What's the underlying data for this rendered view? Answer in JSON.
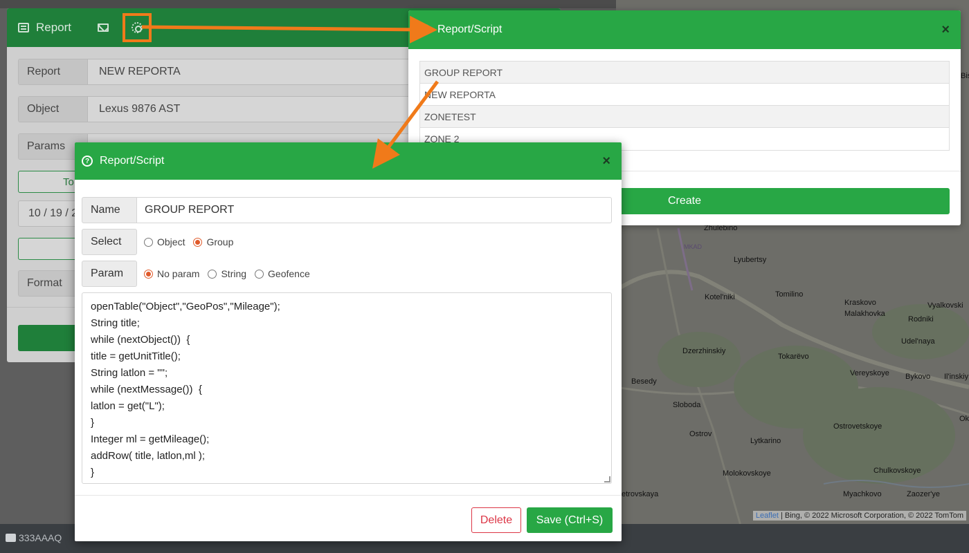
{
  "background_panel": {
    "title": "Report",
    "fields": [
      {
        "label": "Report",
        "value": "NEW REPORTA"
      },
      {
        "label": "Object",
        "value": "Lexus 9876 AST"
      },
      {
        "label": "Params",
        "value": ""
      }
    ],
    "toggle_button_label": "To",
    "date_value": "10 / 19 / 2",
    "format_label": "Format"
  },
  "right_modal": {
    "title": "Report/Script",
    "reports": [
      "GROUP REPORT",
      "NEW REPORTA",
      "ZONETEST",
      "ZONE 2"
    ],
    "create_label": "Create"
  },
  "front_modal": {
    "title": "Report/Script",
    "name_label": "Name",
    "name_value": "GROUP REPORT",
    "select_label": "Select",
    "select_options": [
      {
        "label": "Object",
        "checked": false
      },
      {
        "label": "Group",
        "checked": true
      }
    ],
    "param_label": "Param",
    "param_options": [
      {
        "label": "No param",
        "checked": true
      },
      {
        "label": "String",
        "checked": false
      },
      {
        "label": "Geofence",
        "checked": false
      }
    ],
    "script": "openTable(\"Object\",\"GeoPos\",\"Mileage\");\nString title;\nwhile (nextObject())  {\ntitle = getUnitTitle();\nString latlon = \"\";\nwhile (nextMessage())  {\nlatlon = get(\"L\");\n}\nInteger ml = getMileage();\naddRow( title, latlon,ml );\n}",
    "delete_label": "Delete",
    "save_label": "Save (Ctrl+S)"
  },
  "map": {
    "labels": [
      "Lyubertsy",
      "Kotel'niki",
      "Tomilino",
      "Kraskovo",
      "Malakhovka",
      "Vyalkovski",
      "Rodniki",
      "Udel'naya",
      "Dzerzhinskiy",
      "Tokarëvo",
      "Besedy",
      "Vereyskoye",
      "Bykovo",
      "Il'inskiy",
      "Sloboda",
      "Ostrov",
      "Lytkarino",
      "Ostrovetskoye",
      "Molokovskoye",
      "Chulkovskoye",
      "etrovskaya",
      "Myachkovo",
      "Zaozer'ye",
      "Zhulebino",
      "MKAD",
      "Ok",
      "Bis"
    ],
    "attribution_link": "Leaflet",
    "attribution_text": " | Bing, © 2022 Microsoft Corporation, © 2022 TomTom"
  },
  "bottom_bar": {
    "item": "333AAAQ"
  },
  "colors": {
    "header_green": "#28a745",
    "accent_orange": "#f07a1a",
    "danger_red": "#dc3545"
  }
}
